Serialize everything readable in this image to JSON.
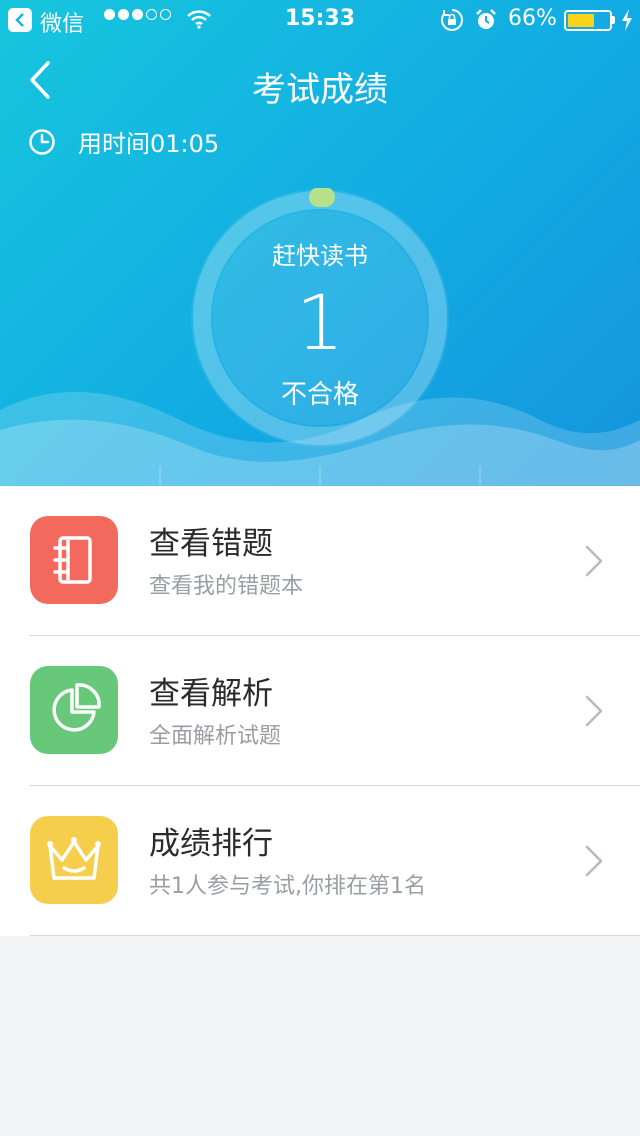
{
  "status_bar": {
    "back_app": "微信",
    "time": "15:33",
    "battery_percent": "66%",
    "battery_level": 0.66,
    "signal_bars_filled": 3,
    "signal_bars_total": 5,
    "icons": [
      "back-app-icon",
      "wifi-icon",
      "orientation-lock-icon",
      "alarm-icon",
      "battery-icon",
      "charging-icon"
    ]
  },
  "nav": {
    "title": "考试成绩",
    "back_icon": "chevron-left-icon"
  },
  "duration": {
    "icon": "clock-icon",
    "text": "用时间01:05"
  },
  "score": {
    "remark": "赶快读书",
    "value": "1",
    "result": "不合格"
  },
  "colors": {
    "header_gradient_start": "#16c6dd",
    "header_gradient_end": "#1594dc",
    "ring_indicator": "#b8e08c",
    "wrong_icon_bg": "#f4695e",
    "analysis_icon_bg": "#66c878",
    "ranking_icon_bg": "#f5cf4b"
  },
  "menu": [
    {
      "title": "查看错题",
      "subtitle": "查看我的错题本",
      "icon": "notebook-icon"
    },
    {
      "title": "查看解析",
      "subtitle": "全面解析试题",
      "icon": "pie-chart-icon"
    },
    {
      "title": "成绩排行",
      "subtitle": "共1人参与考试,你排在第1名",
      "icon": "crown-icon"
    }
  ]
}
